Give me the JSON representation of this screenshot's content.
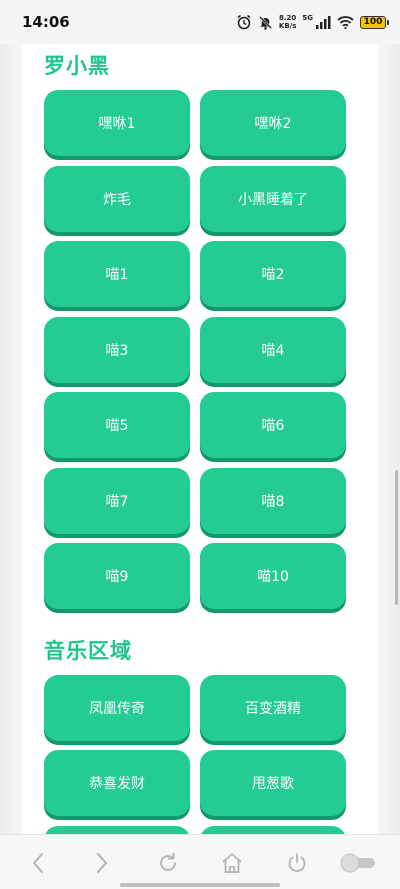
{
  "status_bar": {
    "time": "14:06",
    "net_speed_value": "8.20",
    "net_speed_unit": "KB/s",
    "network_type": "5G",
    "battery": "100"
  },
  "sections": [
    {
      "title": "罗小黑",
      "buttons": [
        "嘿咻1",
        "嘿咻2",
        "炸毛",
        "小黑睡着了",
        "喵1",
        "喵2",
        "喵3",
        "喵4",
        "喵5",
        "喵6",
        "喵7",
        "喵8",
        "喵9",
        "喵10"
      ]
    },
    {
      "title": "音乐区域",
      "buttons": [
        "凤凰传奇",
        "百变酒精",
        "恭喜发财",
        "甩葱歌",
        "",
        ""
      ]
    }
  ],
  "colors": {
    "accent": "#1fc58d",
    "button": "#24cc94",
    "button_shadow": "#139868",
    "battery": "#f0c400"
  },
  "bottom_nav": {
    "icons": [
      "back-icon",
      "forward-icon",
      "refresh-icon",
      "home-icon",
      "power-icon",
      "toggle-switch"
    ],
    "toggle_state": "off"
  }
}
